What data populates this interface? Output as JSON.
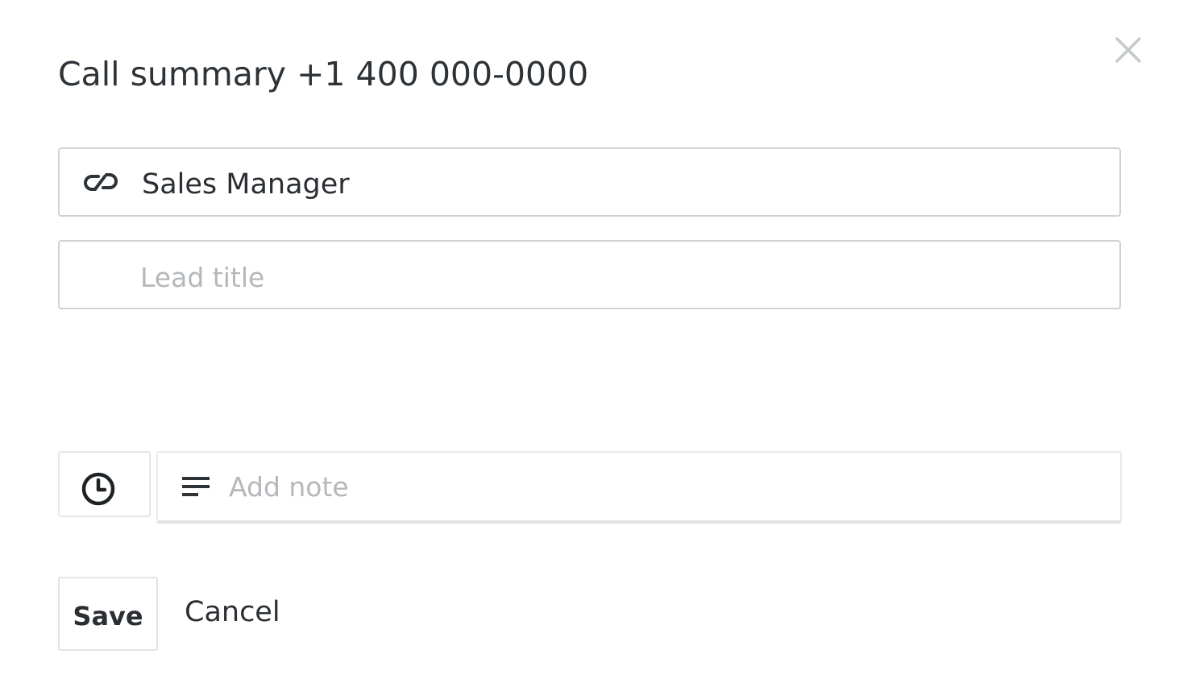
{
  "dialog": {
    "title": "Call summary +1 400 000-0000",
    "close_icon": "close-icon"
  },
  "contact_field": {
    "icon": "link-icon",
    "value": "Sales Manager"
  },
  "lead_field": {
    "placeholder": "Lead title",
    "value": ""
  },
  "note": {
    "time_icon": "clock-icon",
    "lines_icon": "text-lines-icon",
    "placeholder": "Add note",
    "value": ""
  },
  "actions": {
    "save_label": "Save",
    "cancel_label": "Cancel"
  },
  "colors": {
    "text": "#2b2f33",
    "placeholder": "#b4b8bb",
    "border": "#cfd3d6",
    "close": "#c5c9cc"
  }
}
